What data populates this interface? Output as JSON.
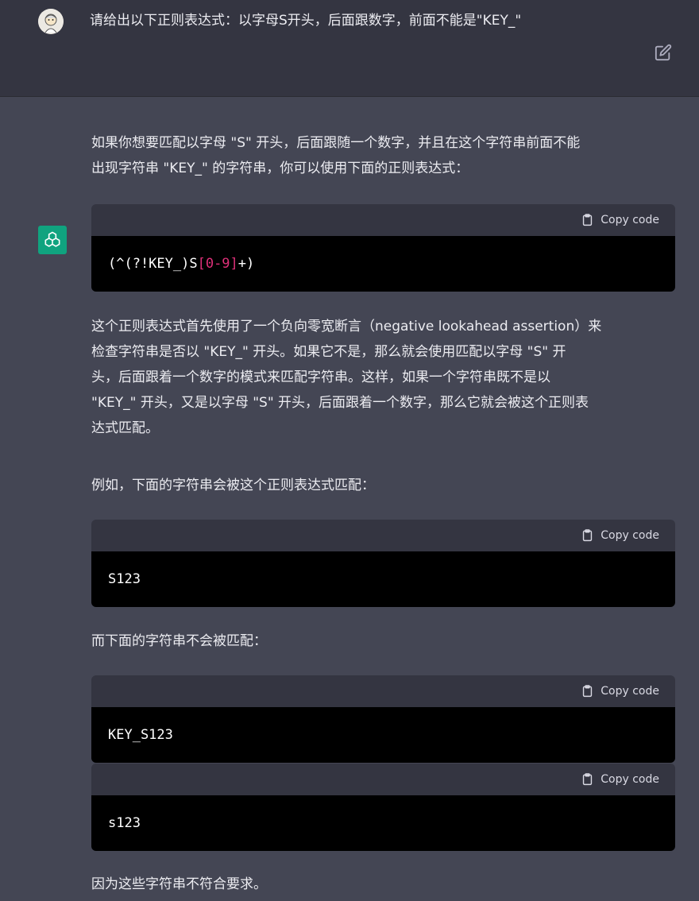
{
  "user": {
    "message": "请给出以下正则表达式：以字母S开头，后面跟数字，前面不能是\"KEY_\""
  },
  "assistant": {
    "intro_line1": "如果你想要匹配以字母 \"S\" 开头，后面跟随一个数字，并且在这个字符串前面不能",
    "intro_line2": "出现字符串 \"KEY_\" 的字符串，你可以使用下面的正则表达式：",
    "regex": {
      "part1": "(^(?!KEY_)S",
      "part2": "[0-9]",
      "part3": "+)"
    },
    "explain_lines": [
      "这个正则表达式首先使用了一个负向零宽断言（negative lookahead assertion）来",
      "检查字符串是否以 \"KEY_\" 开头。如果它不是，那么就会使用匹配以字母 \"S\" 开",
      "头，后面跟着一个数字的模式来匹配字符串。这样，如果一个字符串既不是以",
      "\"KEY_\" 开头，又是以字母 \"S\" 开头，后面跟着一个数字，那么它就会被这个正则表",
      "达式匹配。"
    ],
    "example_intro": "例如，下面的字符串会被这个正则表达式匹配：",
    "example_match": "S123",
    "nonmatch_intro": "而下面的字符串不会被匹配：",
    "nonmatch_1": "KEY_S123",
    "nonmatch_2": "s123",
    "conclusion": "因为这些字符串不符合要求。"
  },
  "copy_label": "Copy code"
}
